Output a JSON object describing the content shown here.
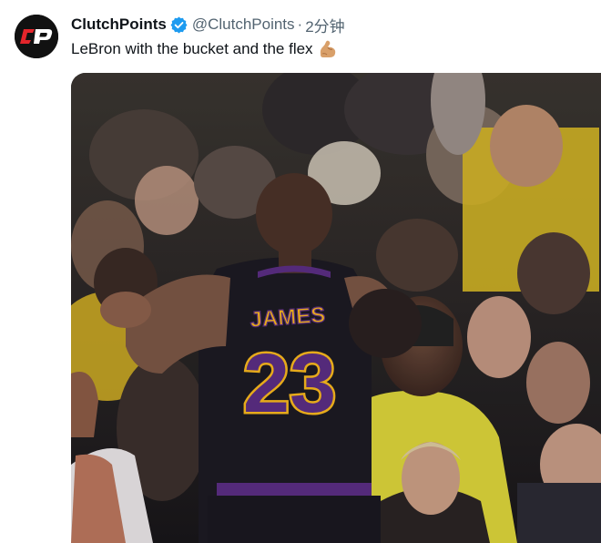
{
  "author": {
    "display_name": "ClutchPoints",
    "handle": "@ClutchPoints",
    "separator": "·",
    "time": "2分钟",
    "avatar_text": "CP",
    "verified_icon": "verified-badge-icon",
    "verified_color": "#1d9bf0"
  },
  "tweet": {
    "text": "LeBron with the bucket and the flex",
    "emoji": "flexed-biceps-emoji"
  },
  "media": {
    "jersey_name": "JAMES",
    "jersey_number": "23",
    "jersey_color": "#1c1a22",
    "trim_color": "#f5b51d",
    "accent_purple": "#5a2d82"
  },
  "colors": {
    "text_primary": "#0f1419",
    "text_secondary": "#536471",
    "brand_red": "#e4252b"
  }
}
